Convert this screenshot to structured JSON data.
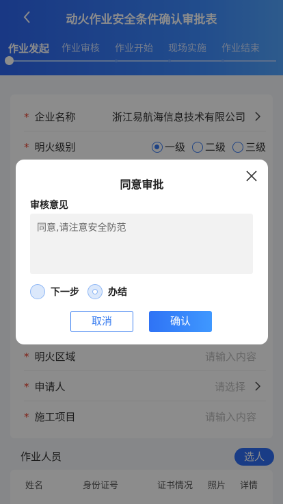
{
  "header": {
    "title": "动火作业安全条件确认审批表",
    "back_icon": "chevron-left-icon",
    "steps": [
      {
        "label": "作业发起",
        "active": true
      },
      {
        "label": "作业审核",
        "active": false
      },
      {
        "label": "作业开始",
        "active": false
      },
      {
        "label": "现场实施",
        "active": false
      },
      {
        "label": "作业结束",
        "active": false
      }
    ]
  },
  "form": {
    "company": {
      "label": "企业名称",
      "value": "浙江易航海信息技术有限公司"
    },
    "fire_level": {
      "label": "明火级别",
      "options": [
        "一级",
        "二级",
        "三级"
      ],
      "selected": "一级"
    },
    "fire_area": {
      "label": "明火区域",
      "placeholder": "请输入内容"
    },
    "applicant": {
      "label": "申请人",
      "placeholder": "请选择"
    },
    "project": {
      "label": "施工项目",
      "placeholder": "请输入内容"
    },
    "required_mark": "*"
  },
  "workers": {
    "title": "作业人员",
    "select_button": "选人",
    "columns": [
      "姓名",
      "身份证号",
      "证书情况",
      "照片",
      "详情"
    ]
  },
  "modal": {
    "title": "同意审批",
    "opinion_label": "审核意见",
    "opinion_value": "同意,请注意安全防范",
    "options": [
      {
        "label": "下一步",
        "selected": false
      },
      {
        "label": "办结",
        "selected": true
      }
    ],
    "cancel_label": "取消",
    "confirm_label": "确认",
    "close_icon": "close-icon"
  },
  "colors": {
    "primary": "#2f6ef4",
    "required": "#e6412f",
    "overlay": "rgba(0,0,0,0.45)"
  }
}
